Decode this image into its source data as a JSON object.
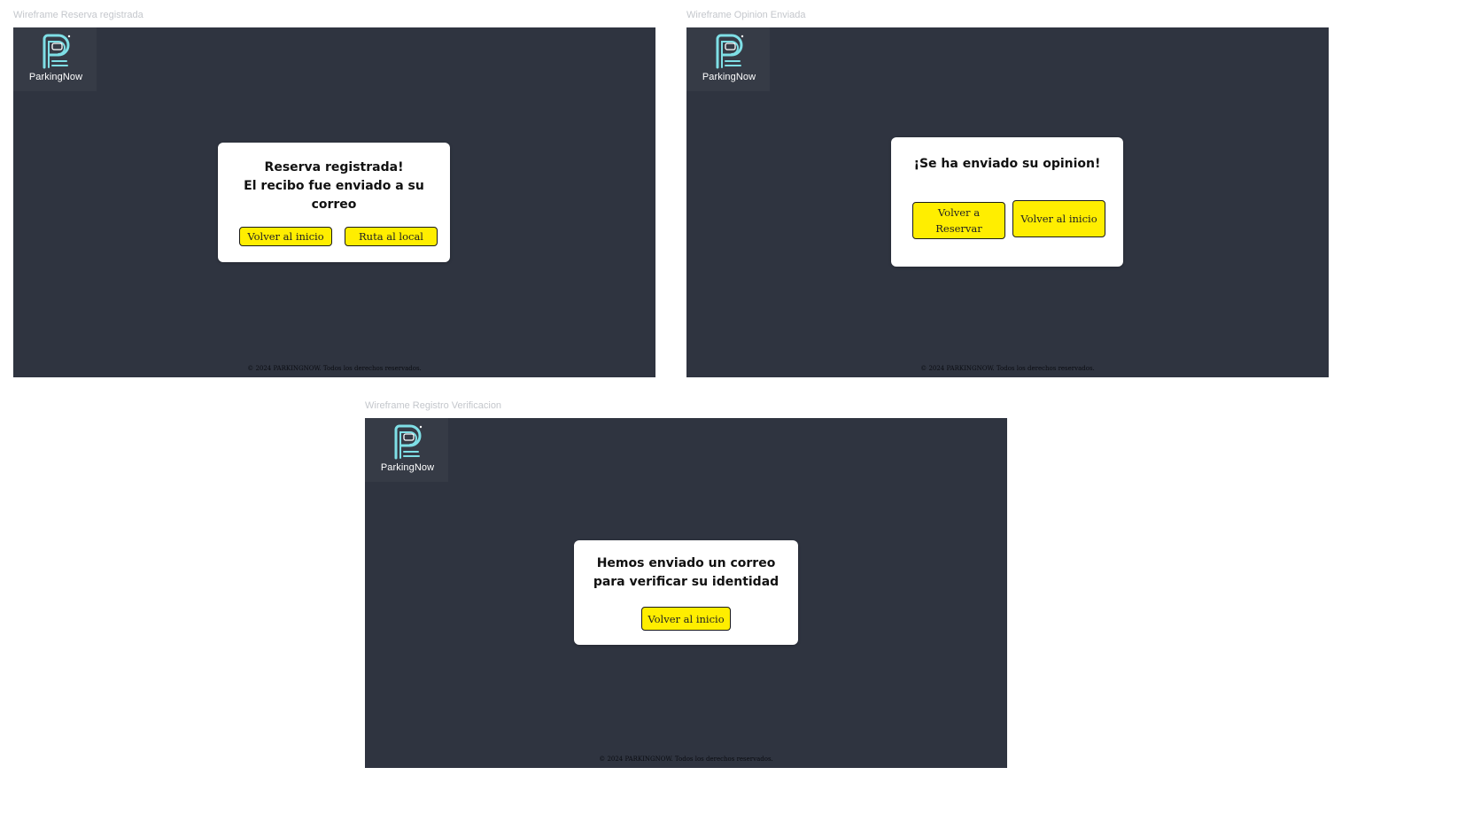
{
  "colors": {
    "frame_bg": "#2f3440",
    "logo_bg": "#363b46",
    "logo_accent": "#7fdfe6",
    "button_bg": "#ffee00",
    "dialog_bg": "#ffffff"
  },
  "brand": {
    "name": "ParkingNow",
    "icon": "parking-p-car-icon"
  },
  "frames": {
    "reserva": {
      "label": "Wireframe Reserva registrada",
      "dialog_lines": [
        "Reserva registrada!",
        "El recibo fue enviado a su",
        "correo"
      ],
      "buttons": [
        "Volver al inicio",
        "Ruta al local"
      ],
      "footer": "© 2024 PARKINGNOW. Todos los derechos reservados."
    },
    "opinion": {
      "label": "Wireframe Opinion Enviada",
      "dialog_lines": [
        "¡Se ha enviado su opinion!"
      ],
      "buttons": [
        "Volver a Reservar",
        "Volver al inicio"
      ],
      "footer": "© 2024 PARKINGNOW. Todos los derechos reservados."
    },
    "verificacion": {
      "label": "Wireframe Registro Verificacion",
      "dialog_lines": [
        "Hemos enviado un correo",
        "para verificar su identidad"
      ],
      "buttons": [
        "Volver al inicio"
      ],
      "footer": "© 2024 PARKINGNOW. Todos los derechos reservados."
    }
  }
}
